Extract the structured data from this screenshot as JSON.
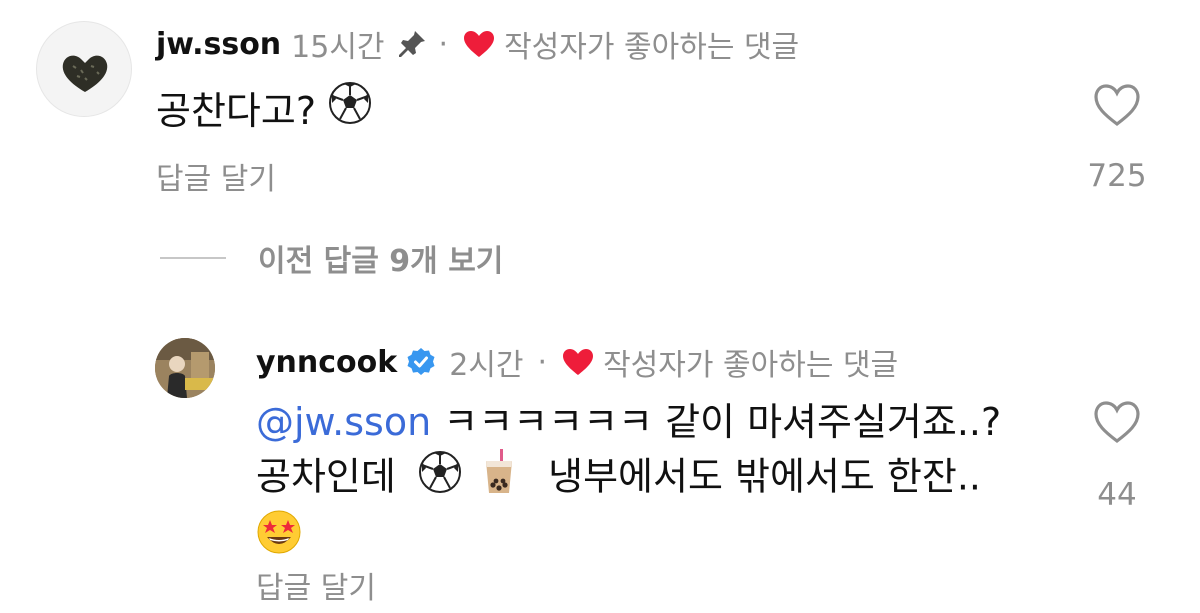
{
  "comments": [
    {
      "username": "jw.sson",
      "time": "15시간",
      "pinned_icon": "pin-icon",
      "separator": "·",
      "liked_by_author": "작성자가 좋아하는 댓글",
      "text": "공찬다고?",
      "emojis": [
        "soccer-ball"
      ],
      "reply_label": "답글 달기",
      "like_count": "725"
    },
    {
      "username": "ynncook",
      "verified": true,
      "time": "2시간",
      "separator": "·",
      "liked_by_author": "작성자가 좋아하는 댓글",
      "mention": "@jw.sson",
      "text_part1": " ㅋㅋㅋㅋㅋㅋ 같이 마셔주실거죠..?",
      "text_part2": "공차인데",
      "text_part3": "냉부에서도 밖에서도 한잔..",
      "emojis": [
        "soccer-ball",
        "bubble-tea",
        "star-struck"
      ],
      "reply_label": "답글 달기",
      "like_count": "44"
    }
  ],
  "view_more_replies": "이전 답글 9개 보기",
  "colors": {
    "heart_red": "#ee1d3a",
    "mention_blue": "#3b6bd8",
    "verified_blue": "#3897f0",
    "muted_text": "#8e8e8e"
  }
}
